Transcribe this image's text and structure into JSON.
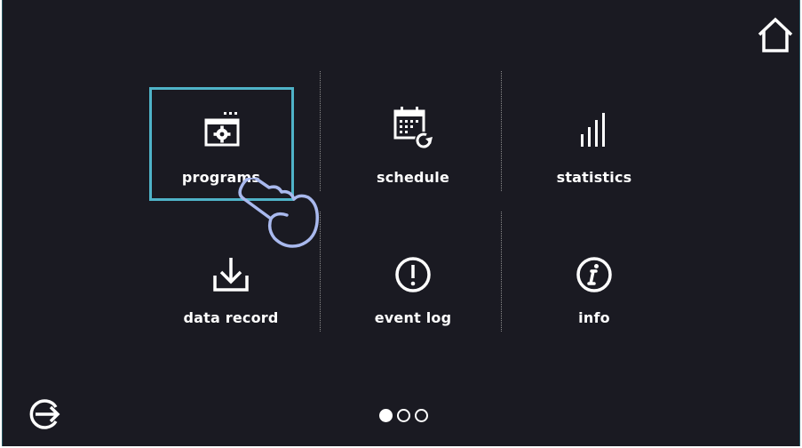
{
  "menu": {
    "items": [
      {
        "id": "programs",
        "label": "programs",
        "icon": "programs-icon"
      },
      {
        "id": "schedule",
        "label": "schedule",
        "icon": "schedule-icon"
      },
      {
        "id": "statistics",
        "label": "statistics",
        "icon": "statistics-icon"
      },
      {
        "id": "data-record",
        "label": "data record",
        "icon": "download-icon"
      },
      {
        "id": "event-log",
        "label": "event log",
        "icon": "exclamation-icon"
      },
      {
        "id": "info",
        "label": "info",
        "icon": "info-icon"
      }
    ],
    "selected": "programs"
  },
  "pager": {
    "pages": 3,
    "current": 1
  },
  "icons": {
    "home": "home-icon",
    "exit": "exit-icon",
    "pointer": "hand-pointer-icon"
  },
  "colors": {
    "background": "#1a1a22",
    "highlight": "#4fb3c8",
    "pointer": "#a9b9ee",
    "foreground": "#ffffff"
  }
}
